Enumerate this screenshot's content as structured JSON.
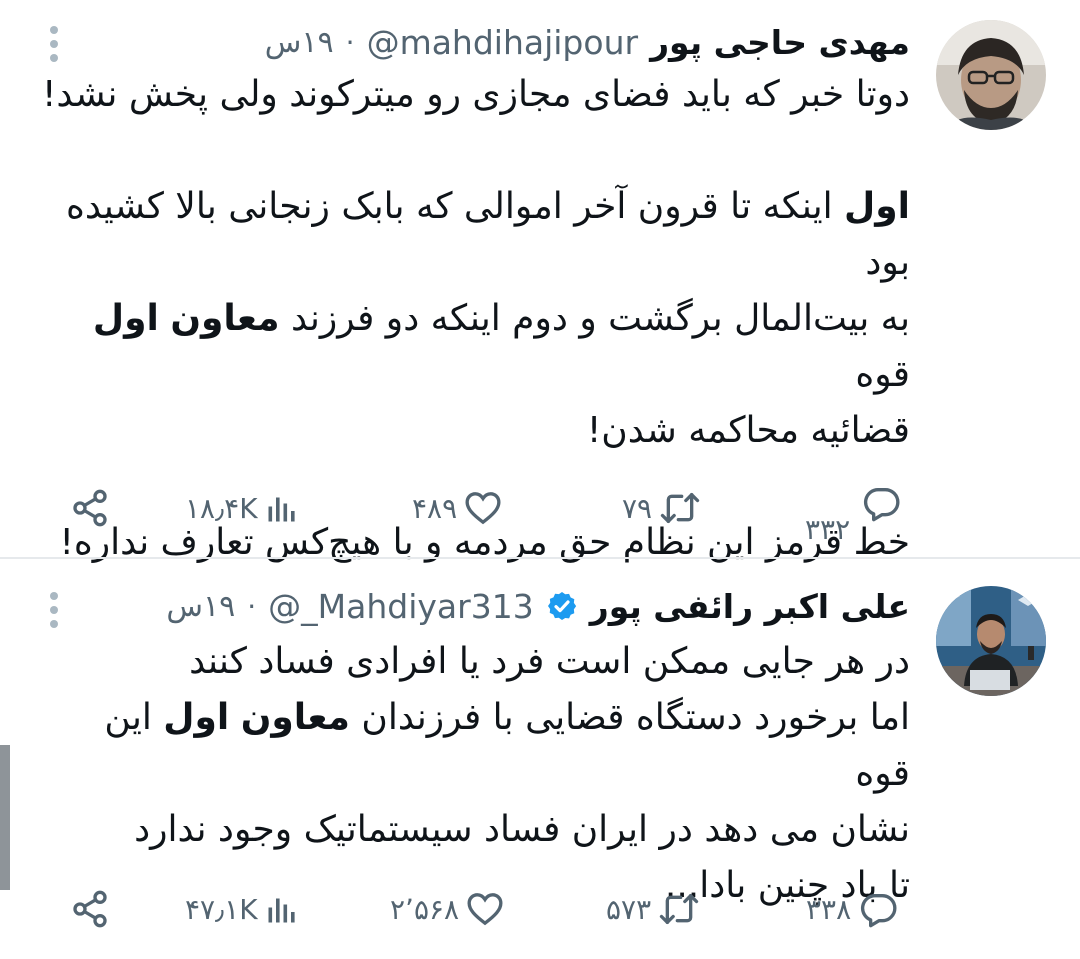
{
  "tweets": [
    {
      "name": "مهدی حاجی پور",
      "handle": "@mahdihajipour",
      "separator": "·",
      "time": "۱۹س",
      "lines": [
        "دوتا خبر که باید فضای مجازی رو میترکوند ولی پخش نشد!",
        "",
        [
          "اول",
          " اینکه تا قرون آخر اموالی که بابک زنجانی بالا کشیده بود"
        ],
        [
          "به بیت‌المال برگشت و دوم اینکه دو فرزند ",
          "معاون",
          " ",
          "اول",
          " قوه"
        ],
        "قضائیه محاکمه شدن!",
        "",
        "خط قرمز این نظام حق مردمه و با هیچ‌کس تعارف نداره!"
      ],
      "stats": {
        "replies": "۳۳۲",
        "retweets": "۷۹",
        "likes": "۴۸۹",
        "views": "۱۸٫۴K"
      }
    },
    {
      "name": "علی اکبر رائفی پور",
      "handle": "@_Mahdiyar313",
      "separator": "·",
      "time": "۱۹س",
      "verified": true,
      "lines": [
        "در هر جایی ممکن است فرد یا افرادی فساد کنند",
        [
          "اما برخورد دستگاه قضایی با فرزندان ",
          "معاون",
          " ",
          "اول",
          " این قوه"
        ],
        "نشان می دهد در ایران فساد سیستماتیک وجود ندارد",
        "تا باد چنین بادا..."
      ],
      "stats": {
        "replies": "۳۳۸",
        "retweets": "۵۷۳",
        "likes": "۲٬۵۶۸",
        "views": "۴۷٫۱K"
      }
    }
  ],
  "icons": {
    "reply": "reply-icon",
    "retweet": "retweet-icon",
    "like": "like-icon",
    "views": "views-icon",
    "share": "share-icon",
    "more": "more-options-icon",
    "verified": "verified-badge-icon"
  },
  "colors": {
    "text": "#0f1419",
    "secondary": "#536471",
    "verified": "#1d9bf0",
    "divider": "#e6e9ec"
  }
}
